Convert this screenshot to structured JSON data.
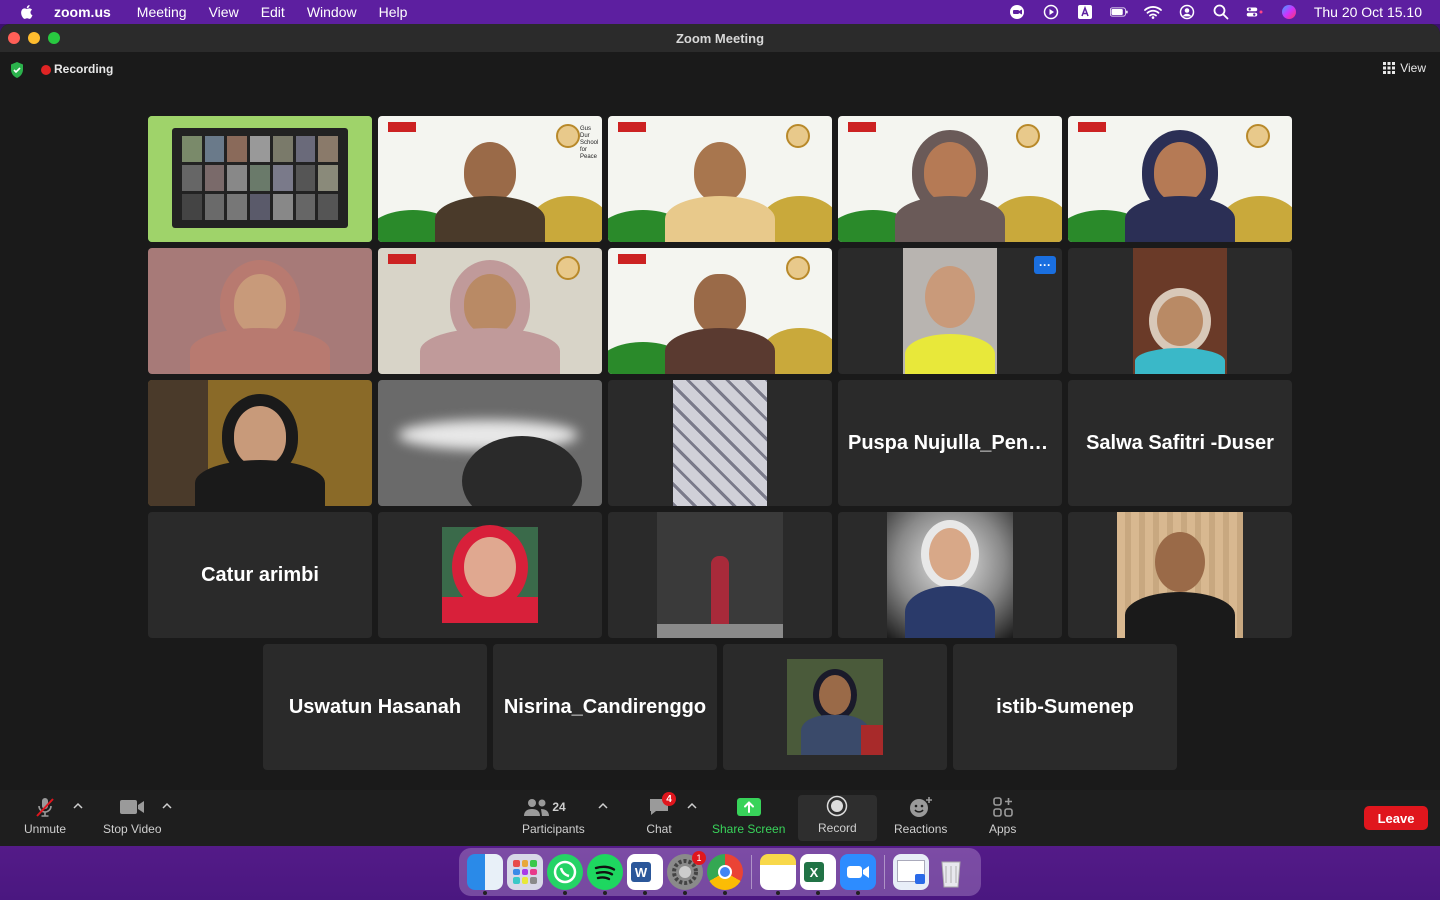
{
  "menubar": {
    "app_name": "zoom.us",
    "items": [
      "Meeting",
      "View",
      "Edit",
      "Window",
      "Help"
    ],
    "clock": "Thu 20 Oct  15.10",
    "color": "#5d1fa0"
  },
  "window": {
    "title": "Zoom Meeting",
    "recording_label": "Recording",
    "view_label": "View"
  },
  "gallery": {
    "name_tiles": {
      "puspa": "Puspa Nujulla_Peng...",
      "salwa": "Salwa Safitri -Duser",
      "catur": "Catur arimbi",
      "uswatun": "Uswatun Hasanah",
      "nisrina": "Nisrina_Candirenggo",
      "istib": "istib-Sumenep"
    },
    "virtual_bg_badge": "Gus Dur School for Peace",
    "active_speaker_border": "#3dd43a"
  },
  "toolbar": {
    "unmute": "Unmute",
    "stop_video": "Stop Video",
    "participants": "Participants",
    "participants_count": "24",
    "chat": "Chat",
    "chat_badge": "4",
    "share_screen": "Share Screen",
    "record": "Record",
    "reactions": "Reactions",
    "apps": "Apps",
    "leave": "Leave",
    "share_color": "#38d35a",
    "leave_color": "#e0161d"
  },
  "dock": {
    "apps": [
      "finder-icon",
      "launchpad-icon",
      "whatsapp-icon",
      "spotify-icon",
      "word-icon",
      "system-preferences-icon",
      "chrome-icon",
      "notes-icon",
      "excel-icon",
      "zoom-icon",
      "preview-icon",
      "trash-icon"
    ],
    "settings_badge": "1"
  }
}
